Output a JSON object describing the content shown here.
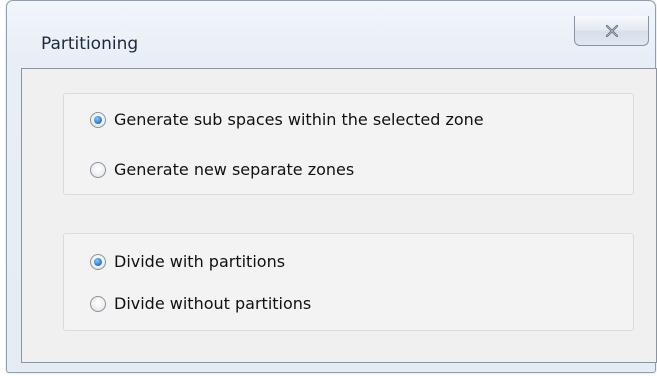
{
  "window": {
    "title": "Partitioning",
    "close_icon": "close-icon"
  },
  "group_zone_mode": {
    "options": [
      {
        "label": "Generate sub spaces within the selected zone",
        "checked": true
      },
      {
        "label": "Generate new separate zones",
        "checked": false
      }
    ]
  },
  "group_divide_mode": {
    "options": [
      {
        "label": "Divide with partitions",
        "checked": true
      },
      {
        "label": "Divide without partitions",
        "checked": false
      }
    ]
  },
  "colors": {
    "radio_selected": "#2f87d6",
    "frame_border": "#8e9fb3"
  }
}
